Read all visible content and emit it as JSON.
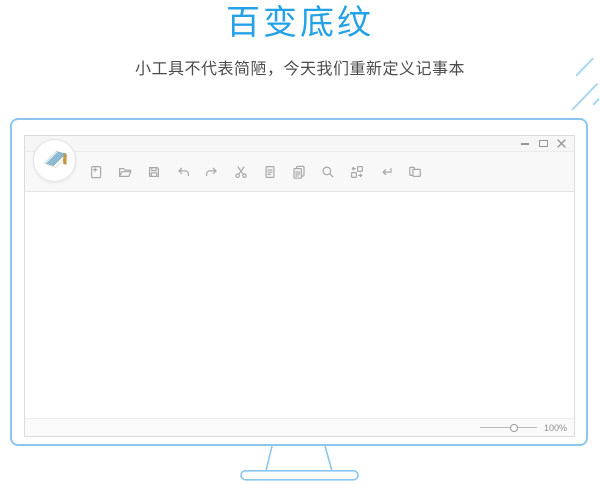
{
  "header": {
    "title": "百变底纹",
    "subtitle": "小工具不代表简陋，今天我们重新定义记事本"
  },
  "colors": {
    "accent_blue": "#25a1e7",
    "monitor_frame_blue": "#8bc6ec",
    "decor_line_blue": "#aad6f1",
    "toolbar_icon_gray": "#a8a8a8",
    "subtitle_gray": "#4c4c4c",
    "logo_cover_blue": "#8cbbd3",
    "logo_spine_gold": "#c79a43"
  },
  "app_window": {
    "logo_icon": "notepad-logo",
    "window_controls": [
      "minimize",
      "maximize",
      "close"
    ],
    "toolbar_icons": [
      "new-file",
      "open-folder",
      "save",
      "undo",
      "redo",
      "cut",
      "document",
      "copy",
      "search",
      "replace",
      "word-wrap",
      "layers"
    ],
    "statusbar": {
      "zoom_label": "100%"
    }
  }
}
